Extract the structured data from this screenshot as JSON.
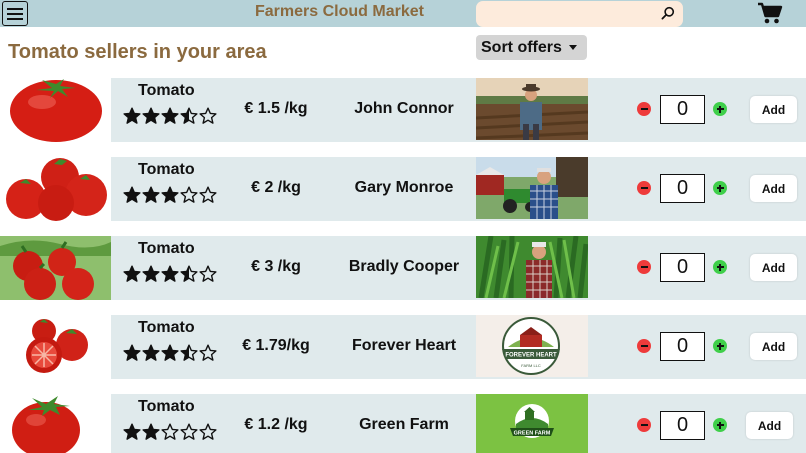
{
  "header": {
    "app_title": "Farmers Cloud Market",
    "search_placeholder": "",
    "menu_icon": "hamburger-icon",
    "search_icon": "search-icon",
    "cart_icon": "cart-icon",
    "bar_color": "#b6d2d8",
    "title_color": "#8b6a3f"
  },
  "page": {
    "title": "Tomato sellers in your area",
    "sort_label": "Sort offers"
  },
  "offers": [
    {
      "product": "Tomato",
      "rating": 3.5,
      "price": "€ 1.5 /kg",
      "seller": "John Connor",
      "quantity": "0",
      "add_label": "Add"
    },
    {
      "product": "Tomato",
      "rating": 3,
      "price": "€ 2 /kg",
      "seller": "Gary Monroe",
      "quantity": "0",
      "add_label": "Add"
    },
    {
      "product": "Tomato",
      "rating": 3.5,
      "price": "€ 3 /kg",
      "seller": "Bradly Cooper",
      "quantity": "0",
      "add_label": "Add"
    },
    {
      "product": "Tomato",
      "rating": 3.5,
      "price": "€ 1.79/kg",
      "seller": "Forever Heart",
      "quantity": "0",
      "add_label": "Add"
    },
    {
      "product": "Tomato",
      "rating": 2,
      "price": "€ 1.2 /kg",
      "seller": "Green Farm",
      "quantity": "0",
      "add_label": "Add"
    }
  ],
  "logos": {
    "forever_heart_text": "FOREVER HEART",
    "green_farm_text": "GREEN FARM"
  }
}
